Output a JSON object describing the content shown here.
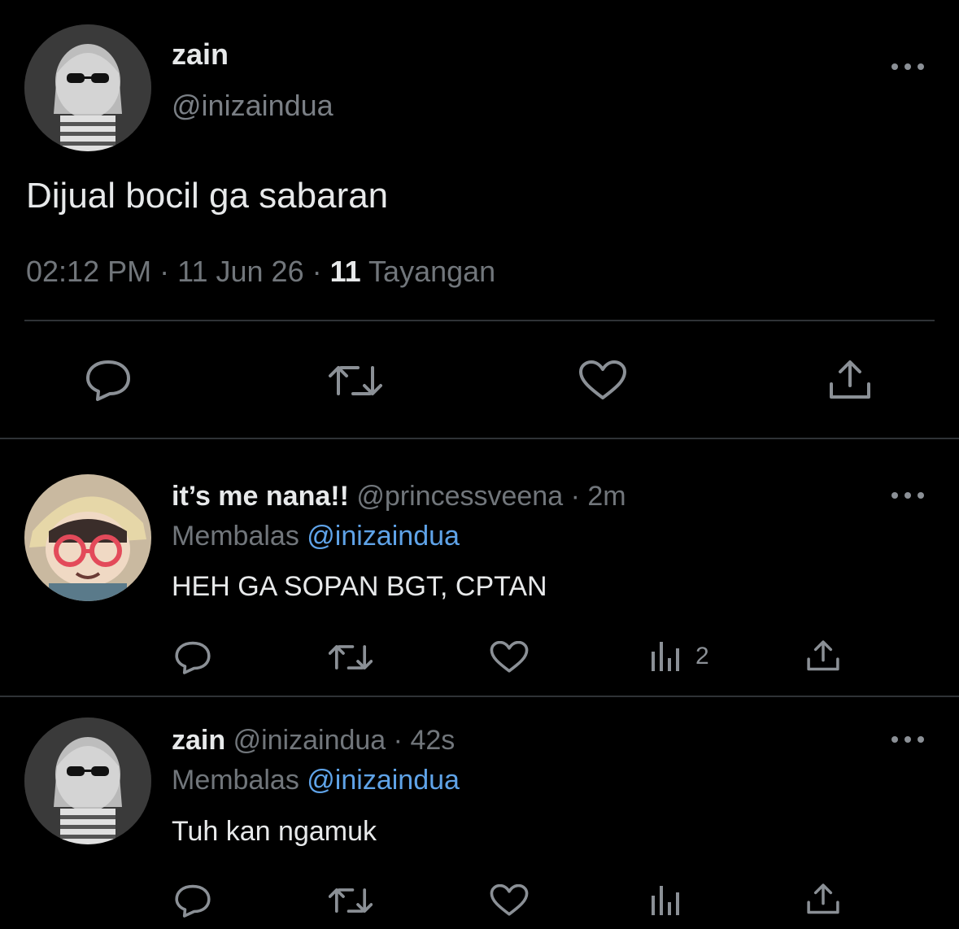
{
  "main_tweet": {
    "display_name": "zain",
    "handle": "@inizaindua",
    "text": "Dijual bocil ga sabaran",
    "time": "02:12 PM",
    "date": "11 Jun 26",
    "separator": "·",
    "views_count": "11",
    "views_label": "Tayangan",
    "actions": [
      "reply-icon",
      "retweet-icon",
      "like-icon",
      "share-icon"
    ]
  },
  "replies": [
    {
      "display_name": "it’s me nana!!",
      "handle": "@princessveena",
      "time": "2m",
      "replying_label": "Membalas",
      "replying_to": "@inizaindua",
      "text": "HEH GA SOPAN BGT, CPTAN",
      "views_count": "2"
    },
    {
      "display_name": "zain",
      "handle": "@inizaindua",
      "time": "42s",
      "replying_label": "Membalas",
      "replying_to": "@inizaindua",
      "text": "Tuh kan ngamuk",
      "views_count": ""
    }
  ],
  "colors": {
    "background": "#000000",
    "text": "#e7e9ea",
    "muted": "#71767b",
    "link": "#5fa3e8",
    "divider": "#2f3336"
  }
}
